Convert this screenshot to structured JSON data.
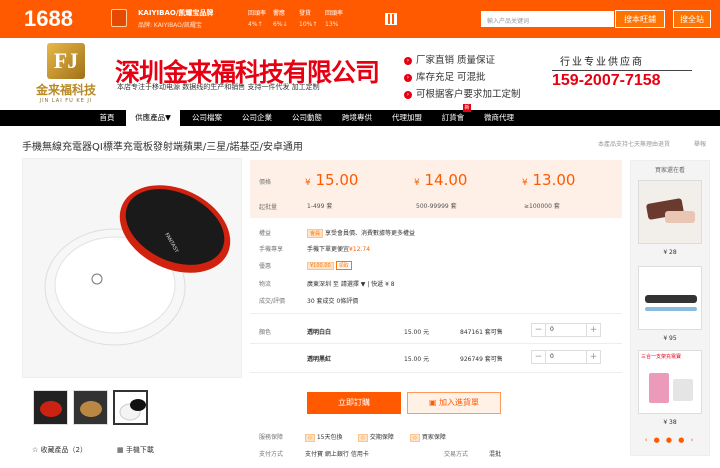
{
  "topbar": {
    "logo": "1688",
    "shop_name": "KAIYIBAO/凯耀宝品牌",
    "shop_sub": "品牌: KAIYIBAO/凯耀宝",
    "metrics": [
      {
        "label": "回頭率",
        "value": "4%↑"
      },
      {
        "label": "響應",
        "value": "6%↓"
      },
      {
        "label": "發貨",
        "value": "10%↑"
      },
      {
        "label": "回頭率",
        "value": "13%"
      }
    ],
    "search_placeholder": "輸入产品关键词",
    "search_shop_btn": "搜本旺鋪",
    "search_all_btn": "搜全站"
  },
  "banner": {
    "logo_cn": "金来福科技",
    "logo_en": "JIN LAI FU KE JI",
    "company": "深圳金来福科技有限公司",
    "company_sub": "本店专注于移动电源 数据线的生产和销售 支持一件代发 加工定制",
    "features": [
      "厂家直销 质量保证",
      "库存充足 可混批",
      "可根据客户要求加工定制"
    ],
    "supply": "行业专业供应商",
    "phone": "159-2007-7158"
  },
  "nav": [
    "首頁",
    "供應產品▼",
    "公司檔案",
    "公司企業",
    "公司動態",
    "跨境專供",
    "代理加盟",
    "訂貨會",
    "微商代理"
  ],
  "nav_new_tag": "新",
  "product": {
    "title": "手機無線充電器QI標準充電板發射端蘋果/三星/諾基亞/安卓通用",
    "note": "本產品支持七天無理由退貨",
    "note2": "舉報",
    "collect": "收藏產品（2）",
    "compare": "手機下載"
  },
  "pricing": {
    "price_label": "價格",
    "qty_label": "起批量",
    "tiers": [
      {
        "price": "15.00",
        "range": "1-499 套"
      },
      {
        "price": "14.00",
        "range": "500-99999 套"
      },
      {
        "price": "13.00",
        "range": "≥100000 套"
      }
    ],
    "currency": "¥"
  },
  "info": {
    "rows": [
      {
        "label": "權益",
        "text": "享受會員價、消費數據等更多權益",
        "badge": "會員"
      },
      {
        "label": "手機專享",
        "text": "手機下單更便宜",
        "extra": "¥12.74"
      },
      {
        "label": "優惠",
        "text": "¥100.00",
        "extra": "領取"
      },
      {
        "label": "物流",
        "text": "廣東深圳 至 請選擇 ▼ | 快遞 ¥ 8"
      },
      {
        "label": "成交/評價",
        "text": "30 套成交  0條評價"
      }
    ]
  },
  "sku": {
    "label": "顏色",
    "items": [
      {
        "name": "透明白白",
        "price": "15.00 元",
        "stock": "847161 套可售",
        "qty": "0"
      },
      {
        "name": "透明黑紅",
        "price": "15.00 元",
        "stock": "926749 套可售",
        "qty": "0"
      }
    ]
  },
  "actions": {
    "order": "立即訂購",
    "cart": "加入進貨單"
  },
  "service": {
    "label": "服務保障",
    "items": [
      "15天包換",
      "交期保障",
      "買家保障"
    ],
    "pay_label": "支付方式",
    "pay_text": "支付寶  網上銀行  信用卡",
    "trade_label": "交易方式",
    "trade_text": "混批"
  },
  "sidebar": {
    "title": "買家還在看",
    "items": [
      {
        "price": "¥ 28"
      },
      {
        "price": "¥ 95"
      },
      {
        "price": "¥ 38"
      }
    ],
    "third_caption": "三合一支架充電寶"
  },
  "colors": {
    "brand": "#ff5a00",
    "company_red": "#e60012"
  }
}
